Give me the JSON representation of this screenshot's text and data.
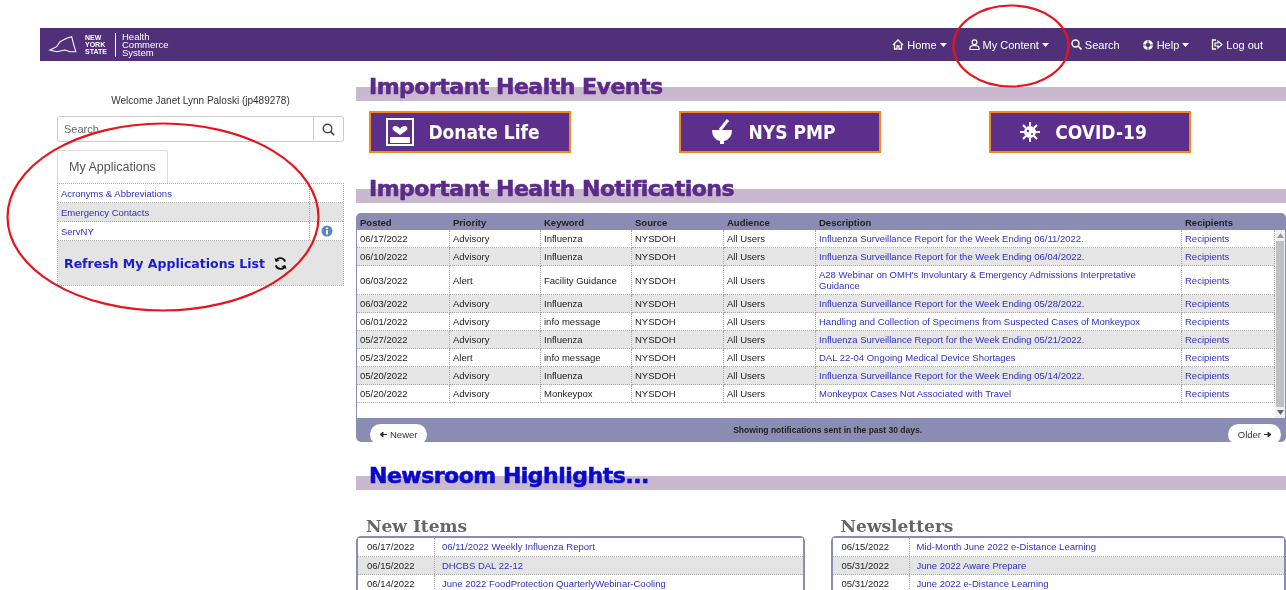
{
  "header": {
    "logo_state": "NEW YORK STATE",
    "logo_title": "Health Commerce System",
    "nav": [
      {
        "label": "Home",
        "dropdown": true
      },
      {
        "label": "My Content",
        "dropdown": true
      },
      {
        "label": "Search",
        "dropdown": false
      },
      {
        "label": "Help",
        "dropdown": true
      },
      {
        "label": "Log out",
        "dropdown": false
      }
    ]
  },
  "sidebar": {
    "welcome": "Welcome Janet Lynn Paloski (jp489278)",
    "search": {
      "placeholder": "Search"
    },
    "tabs": [
      {
        "label": "My Applications",
        "selected": true
      }
    ],
    "applications": [
      {
        "label": "Acronyms & Abbreviations",
        "info": false
      },
      {
        "label": "Emergency Contacts",
        "info": false
      },
      {
        "label": "ServNY",
        "info": true
      }
    ],
    "refresh": "Refresh My Applications List"
  },
  "events": {
    "title": "Important Health Events",
    "buttons": [
      {
        "label": "Donate Life"
      },
      {
        "label": "NYS PMP"
      },
      {
        "label": "COVID-19"
      }
    ]
  },
  "notifications": {
    "title": "Important Health Notifications",
    "columns": [
      "Posted",
      "Priority",
      "Keyword",
      "Source",
      "Audience",
      "Description",
      "Recipients"
    ],
    "rows": [
      [
        "06/17/2022",
        "Advisory",
        "Influenza",
        "NYSDOH",
        "All Users",
        "Influenza Surveillance Report for the Week Ending 06/11/2022.",
        "Recipients"
      ],
      [
        "06/10/2022",
        "Advisory",
        "Influenza",
        "NYSDOH",
        "All Users",
        "Influenza Surveillance Report for the Week Ending 06/04/2022.",
        "Recipients"
      ],
      [
        "06/03/2022",
        "Alert",
        "Facility Guidance",
        "NYSDOH",
        "All Users",
        "A28 Webinar on OMH's Involuntary & Emergency Admissions Interpretative Guidance",
        "Recipients"
      ],
      [
        "06/03/2022",
        "Advisory",
        "Influenza",
        "NYSDOH",
        "All Users",
        "Influenza Surveillance Report for the Week Ending 05/28/2022.",
        "Recipients"
      ],
      [
        "06/01/2022",
        "Advisory",
        "info message",
        "NYSDOH",
        "All Users",
        "Handling and Collection of Specimens from Suspected Cases of Monkeypox",
        "Recipients"
      ],
      [
        "05/27/2022",
        "Advisory",
        "Influenza",
        "NYSDOH",
        "All Users",
        "Influenza Surveillance Report for the Week Ending 05/21/2022.",
        "Recipients"
      ],
      [
        "05/23/2022",
        "Alert",
        "info message",
        "NYSDOH",
        "All Users",
        "DAL 22-04 Ongoing Medical Device Shortages",
        "Recipients"
      ],
      [
        "05/20/2022",
        "Advisory",
        "Influenza",
        "NYSDOH",
        "All Users",
        "Influenza Surveillance Report for the Week Ending 05/14/2022.",
        "Recipients"
      ],
      [
        "05/20/2022",
        "Advisory",
        "Monkeypox",
        "NYSDOH",
        "All Users",
        "Monkeypox Cases Not Associated with Travel",
        "Recipients"
      ]
    ],
    "newer": "Newer",
    "older": "Older",
    "footer": "Showing notifications sent in the past 30 days."
  },
  "newsroom": {
    "title": "Newsroom Highlights...",
    "lists": [
      {
        "title": "New Items",
        "rows": [
          [
            "06/17/2022",
            "06/11/2022 Weekly Influenza Report"
          ],
          [
            "06/15/2022",
            "DHCBS DAL 22-12"
          ],
          [
            "06/14/2022",
            "June 2022 FoodProtection QuarterlyWebinar-Cooling"
          ]
        ]
      },
      {
        "title": "Newsletters",
        "rows": [
          [
            "06/15/2022",
            "Mid-Month June 2022 e-Distance Learning"
          ],
          [
            "05/31/2022",
            "June 2022 Aware Prepare"
          ],
          [
            "05/31/2022",
            "June 2022 e-Distance Learning"
          ]
        ]
      }
    ]
  },
  "annotations": [
    {
      "kind": "ellipse"
    },
    {
      "kind": "ellipse"
    }
  ]
}
